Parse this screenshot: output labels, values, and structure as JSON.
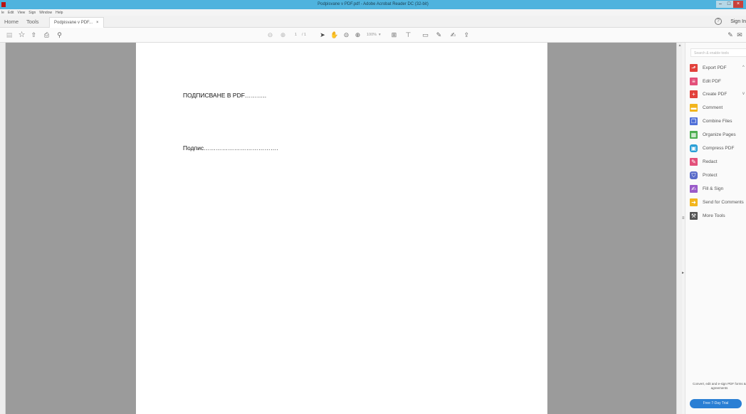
{
  "window": {
    "title": "Podpisvane v PDF.pdf - Adobe Acrobat Reader DC (32-bit)",
    "controls": {
      "minimize": "–",
      "maximize": "□",
      "close": "×"
    }
  },
  "menubar": {
    "items": [
      "le",
      "Edit",
      "View",
      "Sign",
      "Window",
      "Help"
    ]
  },
  "tabs": {
    "home": "Home",
    "tools": "Tools",
    "document": "Podpisvane v PDF...",
    "document_close": "×",
    "help": "?",
    "sign_in": "Sign In"
  },
  "toolbar": {
    "icons": [
      "save-icon",
      "bookmark-star-icon",
      "upload-cloud-icon",
      "print-icon",
      "zoom-search-icon",
      "prev-page-icon",
      "next-page-icon",
      "select-arrow-icon",
      "hand-icon",
      "zoom-out-icon",
      "zoom-in-icon",
      "fit-page-icon",
      "scroll-mode-icon",
      "comment-icon",
      "highlight-pen-icon",
      "sign-icon",
      "share-icon",
      "attach-icon",
      "email-icon"
    ],
    "page_current": "1",
    "page_total": "/ 1",
    "zoom": "100%",
    "zoom_caret": "▾"
  },
  "document": {
    "line1": "ПОДПИСВАНЕ В PDF………..",
    "line2": "Подпис………………………………."
  },
  "right_pane": {
    "search_placeholder": "Search & enable tools",
    "tools": [
      {
        "label": "Export PDF",
        "icon": "export-pdf-icon",
        "color": "#e2413b",
        "expand": "^"
      },
      {
        "label": "Edit PDF",
        "icon": "edit-pdf-icon",
        "color": "#e3507a",
        "expand": ""
      },
      {
        "label": "Create PDF",
        "icon": "create-pdf-icon",
        "color": "#e2413b",
        "expand": "v"
      },
      {
        "label": "Comment",
        "icon": "comment-icon",
        "color": "#f2b51d",
        "expand": ""
      },
      {
        "label": "Combine Files",
        "icon": "combine-files-icon",
        "color": "#4f6fd8",
        "expand": ""
      },
      {
        "label": "Organize Pages",
        "icon": "organize-pages-icon",
        "color": "#4cae4f",
        "expand": ""
      },
      {
        "label": "Compress PDF",
        "icon": "compress-pdf-icon",
        "color": "#2a9fd6",
        "expand": ""
      },
      {
        "label": "Redact",
        "icon": "redact-icon",
        "color": "#e3507a",
        "expand": ""
      },
      {
        "label": "Protect",
        "icon": "protect-icon",
        "color": "#5a6cc9",
        "expand": ""
      },
      {
        "label": "Fill & Sign",
        "icon": "fill-sign-icon",
        "color": "#9a5ac9",
        "expand": ""
      },
      {
        "label": "Send for Comments",
        "icon": "send-comments-icon",
        "color": "#f2b51d",
        "expand": ""
      },
      {
        "label": "More Tools",
        "icon": "more-tools-icon",
        "color": "#555555",
        "expand": ""
      }
    ],
    "promo_text": "Convert, edit and e-sign PDF forms & agreements",
    "trial_button": "Free 7-Day Trial"
  },
  "colors": {
    "title_bar": "#4fb3de",
    "doc_background": "#9b9b9b",
    "trial_button": "#2a7fd4"
  }
}
